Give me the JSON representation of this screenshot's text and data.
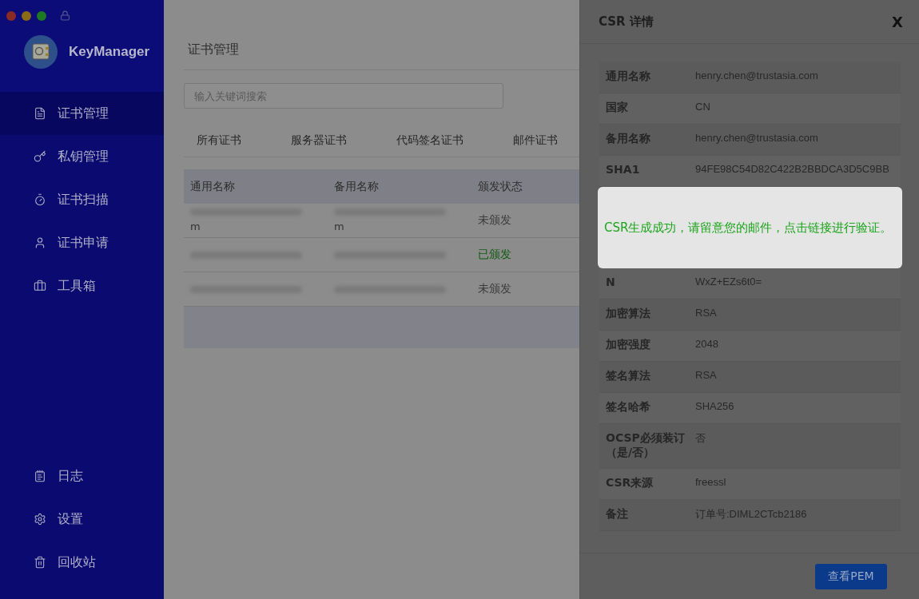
{
  "window": {
    "controls": [
      {
        "color": "#8c2a24"
      },
      {
        "color": "#8a6a14"
      },
      {
        "color": "#1e7a22"
      }
    ]
  },
  "app": {
    "name": "KeyManager"
  },
  "sidebar": {
    "items": [
      {
        "label": "证书管理",
        "selected": true
      },
      {
        "label": "私钥管理",
        "selected": false
      },
      {
        "label": "证书扫描",
        "selected": false
      },
      {
        "label": "证书申请",
        "selected": false
      },
      {
        "label": "工具箱",
        "selected": false
      }
    ],
    "bottom_items": [
      {
        "label": "日志",
        "selected": false
      },
      {
        "label": "设置",
        "selected": false
      },
      {
        "label": "回收站",
        "selected": false
      }
    ]
  },
  "page": {
    "title": "证书管理",
    "search": {
      "placeholder": "输入关键词搜索"
    },
    "tabs": [
      {
        "label": "所有证书",
        "selected": false
      },
      {
        "label": "服务器证书",
        "selected": false
      },
      {
        "label": "代码签名证书",
        "selected": false
      },
      {
        "label": "邮件证书",
        "selected": false
      }
    ],
    "table": {
      "columns": [
        "通用名称",
        "备用名称",
        "颁发状态"
      ],
      "rows": [
        {
          "common_name": {
            "visible_text": "m"
          },
          "alt_name": {
            "visible_text": "m"
          },
          "status": {
            "text": "未颁发",
            "issued": false
          }
        },
        {
          "common_name": {},
          "alt_name": {},
          "status": {
            "text": "已颁发",
            "issued": true
          }
        },
        {
          "common_name": {},
          "alt_name": {},
          "status": {
            "text": "未颁发",
            "issued": false
          }
        }
      ]
    }
  },
  "drawer": {
    "title": "CSR 详情",
    "close": "X",
    "rows_above": [
      {
        "label": "通用名称",
        "value": "henry.chen@trustasia.com"
      },
      {
        "label": "国家",
        "value": "CN"
      },
      {
        "label": "备用名称",
        "value": "henry.chen@trustasia.com"
      },
      {
        "label": "SHA1",
        "value": "94FE98C54D82C422B2BBDCA3D5C9BB"
      }
    ],
    "toast": {
      "message": "CSR生成成功，请留意您的邮件，点击链接进行验证。"
    },
    "rows_below": [
      {
        "label": "N",
        "value": "WxZ+EZs6t0="
      },
      {
        "label": "加密算法",
        "value": "RSA"
      },
      {
        "label": "加密强度",
        "value": "2048"
      },
      {
        "label": "签名算法",
        "value": "RSA"
      },
      {
        "label": "签名哈希",
        "value": "SHA256"
      },
      {
        "label": "OCSP必须装订（是/否）",
        "value": "否"
      },
      {
        "label": "CSR来源",
        "value": "freessl"
      },
      {
        "label": "备注",
        "value": "订单号:DIML2CTcb2186"
      }
    ],
    "button": "查看PEM"
  }
}
